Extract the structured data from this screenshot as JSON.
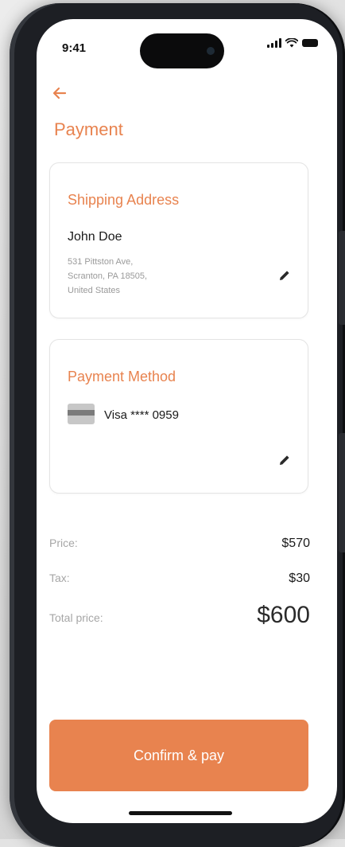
{
  "status_bar": {
    "time": "9:41"
  },
  "icons": {
    "back": "arrow-left-icon",
    "edit": "pencil-icon",
    "card": "credit-card-icon",
    "signal": "signal-icon",
    "wifi": "wifi-icon",
    "battery": "battery-icon"
  },
  "colors": {
    "accent": "#e8834f",
    "muted": "#a6a6a6"
  },
  "header": {
    "title": "Payment"
  },
  "shipping": {
    "title": "Shipping Address",
    "name": "John Doe",
    "address_line1": "531 Pittston Ave,",
    "address_line2": "Scranton, PA 18505,",
    "address_line3": "United States"
  },
  "payment_method": {
    "title": "Payment Method",
    "card_label": "Visa **** 0959"
  },
  "summary": {
    "price_label": "Price:",
    "price_value": "$570",
    "tax_label": "Tax:",
    "tax_value": "$30",
    "total_label": "Total price:",
    "total_value": "$600"
  },
  "actions": {
    "confirm_label": "Confirm & pay"
  }
}
